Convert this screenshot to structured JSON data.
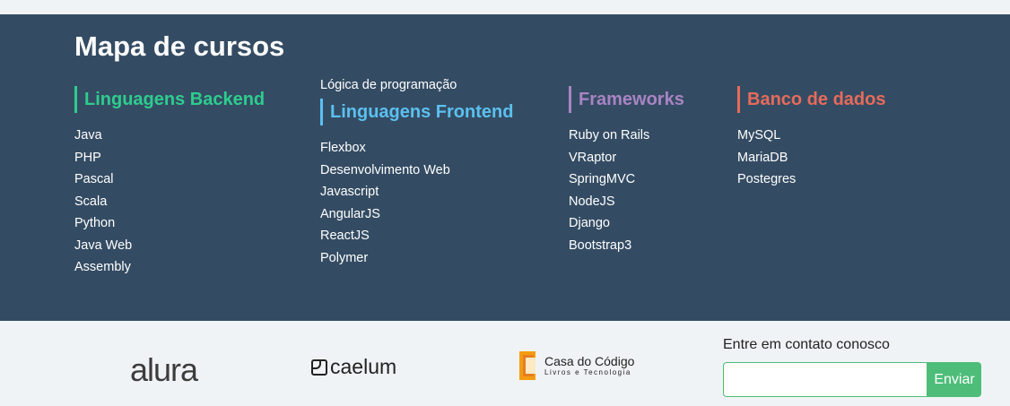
{
  "map": {
    "title": "Mapa de cursos",
    "categories": [
      {
        "title": "Linguagens Backend",
        "color": "#2ecc8e",
        "items": [
          "Java",
          "PHP",
          "Pascal",
          "Scala",
          "Python",
          "Java Web",
          "Assembly"
        ]
      },
      {
        "pre_item": "Lógica de programação",
        "title": "Linguagens Frontend",
        "color": "#5bc0f0",
        "items": [
          "Flexbox",
          "Desenvolvimento Web",
          "Javascript",
          "AngularJS",
          "ReactJS",
          "Polymer"
        ]
      },
      {
        "title": "Frameworks",
        "color": "#a984c3",
        "items": [
          "Ruby on Rails",
          "VRaptor",
          "SpringMVC",
          "NodeJS",
          "Django",
          "Bootstrap3"
        ]
      },
      {
        "title": "Banco de dados",
        "color": "#e66b5b",
        "items": [
          "MySQL",
          "MariaDB",
          "Postegres"
        ]
      }
    ]
  },
  "footer": {
    "logos": {
      "alura": "alura",
      "caelum": "caelum",
      "cdc_name": "Casa do Código",
      "cdc_sub": "Livros e Tecnologia"
    },
    "contact": {
      "label": "Entre em contato conosco",
      "input_value": "",
      "button_label": "Enviar"
    }
  },
  "colors": {
    "map_bg": "#344c63",
    "page_bg": "#f0f3f5",
    "accent_green": "#4dbd79",
    "cdc_orange": "#f39c12"
  }
}
